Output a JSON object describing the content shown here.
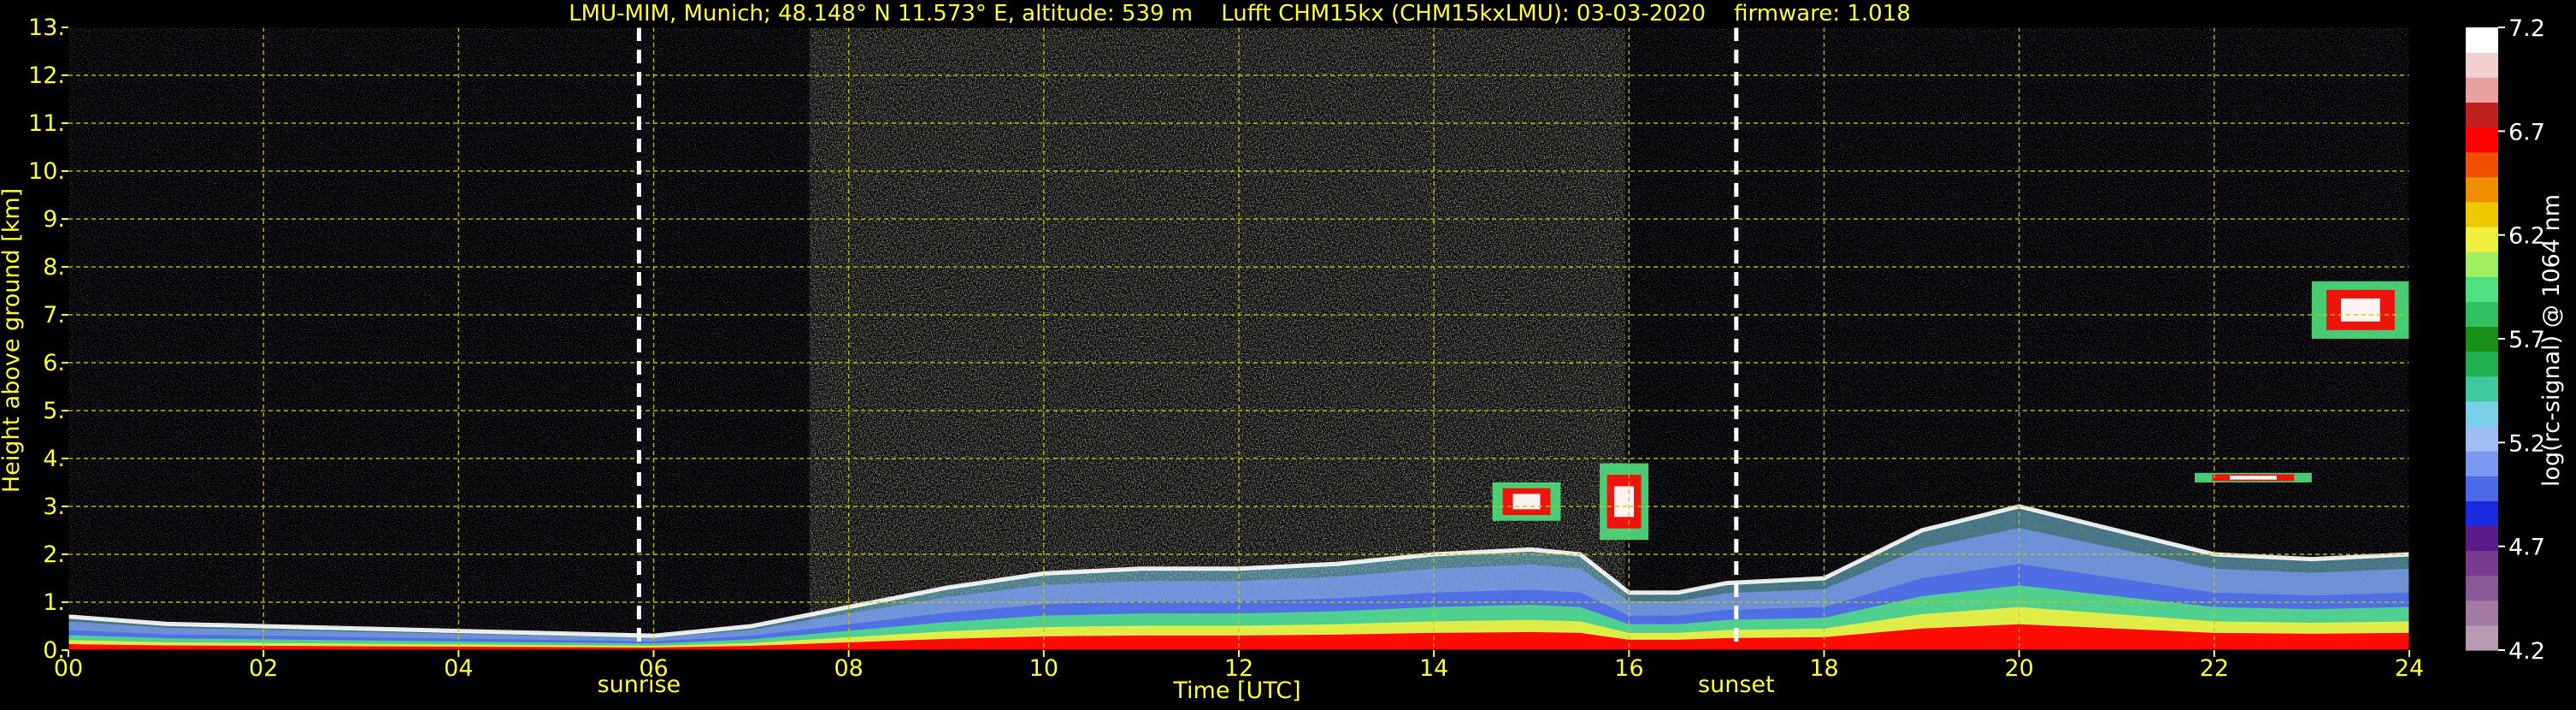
{
  "colors": {
    "background": "#000000",
    "text_yellow": "#ffff33",
    "grid": "#c8c800",
    "marker_line": "#ffffff",
    "colorbar_text": "#ffffff"
  },
  "chart_data": {
    "type": "heatmap",
    "title": "LMU-MIM, Munich; 48.148° N 11.573° E, altitude: 539 m    Lufft CHM15kx (CHM15kxLMU): 03-03-2020    firmware: 1.018",
    "xlabel": "Time [UTC]",
    "ylabel": "Height above ground [km]",
    "xlim": [
      0,
      24
    ],
    "ylim": [
      0,
      13
    ],
    "x_ticks": [
      0,
      2,
      4,
      6,
      8,
      10,
      12,
      14,
      16,
      18,
      20,
      22,
      24
    ],
    "x_tick_labels": [
      "00",
      "02",
      "04",
      "06",
      "08",
      "10",
      "12",
      "14",
      "16",
      "18",
      "20",
      "22",
      "24"
    ],
    "y_ticks": [
      0,
      1,
      2,
      3,
      4,
      5,
      6,
      7,
      8,
      9,
      10,
      11,
      12,
      13
    ],
    "y_tick_labels": [
      "0.",
      "1.",
      "2.",
      "3.",
      "4.",
      "5.",
      "6.",
      "7.",
      "8.",
      "9.",
      "10.",
      "11.",
      "12.",
      "13."
    ],
    "grid": true,
    "markers": [
      {
        "label": "sunrise",
        "x": 5.85
      },
      {
        "label": "sunset",
        "x": 17.1
      }
    ],
    "colorbar": {
      "label": "log(rc-signal) @ 1064 nm",
      "min": 4.2,
      "max": 7.2,
      "ticks": [
        4.2,
        4.7,
        5.2,
        5.7,
        6.2,
        6.7,
        7.2
      ],
      "tick_labels": [
        "4.2",
        "4.7",
        "5.2",
        "5.7",
        "6.2",
        "6.7",
        "7.2"
      ],
      "colors": [
        "#b89ab0",
        "#a07aa0",
        "#8a5a96",
        "#7a3a8e",
        "#5a1a8a",
        "#1a2ae0",
        "#4a6ae8",
        "#7a9af0",
        "#a0bcf4",
        "#7ad0e8",
        "#40c8a0",
        "#20b050",
        "#189018",
        "#30c060",
        "#50e080",
        "#a0f060",
        "#f0f040",
        "#f0c800",
        "#f09000",
        "#f05000",
        "#ff0000",
        "#c02020",
        "#e8a0a0",
        "#f0d0d0",
        "#ffffff"
      ]
    },
    "features": [
      {
        "kind": "boundary layer",
        "x": [
          0,
          1,
          2,
          3,
          4,
          5,
          6,
          7,
          8,
          9,
          10,
          11,
          12,
          13,
          14,
          15,
          15.5,
          16,
          16.5,
          17,
          18,
          19,
          20,
          21,
          22,
          23,
          24
        ],
        "y": [
          0.7,
          0.55,
          0.5,
          0.45,
          0.4,
          0.35,
          0.3,
          0.5,
          0.9,
          1.3,
          1.6,
          1.7,
          1.7,
          1.8,
          2.0,
          2.1,
          2.0,
          1.2,
          1.2,
          1.4,
          1.5,
          2.5,
          3.0,
          2.5,
          2.0,
          1.9,
          2.0
        ]
      },
      {
        "kind": "cloud",
        "x": [
          14.6,
          15.3
        ],
        "y": [
          2.7,
          3.5
        ]
      },
      {
        "kind": "cloud",
        "x": [
          15.7,
          16.2
        ],
        "y": [
          2.3,
          3.9
        ]
      },
      {
        "kind": "cloud",
        "x": [
          21.8,
          23.0
        ],
        "y": [
          3.5,
          3.7
        ]
      },
      {
        "kind": "cloud",
        "x": [
          23.0,
          24.0
        ],
        "y": [
          6.5,
          7.7
        ]
      }
    ]
  }
}
